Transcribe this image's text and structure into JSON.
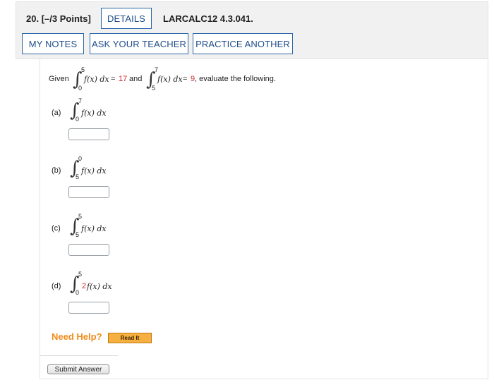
{
  "header": {
    "question_number": "20.",
    "points": "[–/3 Points]",
    "details_label": "DETAILS",
    "code": "LARCALC12 4.3.041.",
    "my_notes_label": "MY NOTES",
    "ask_teacher_label": "ASK YOUR TEACHER",
    "practice_label": "PRACTICE ANOTHER"
  },
  "given": {
    "prefix": "Given",
    "int1": {
      "lower": "0",
      "upper": "5",
      "integrand": "f(x) dx",
      "equals": "=",
      "value": "17"
    },
    "and": "and",
    "int2": {
      "lower": "5",
      "upper": "7",
      "integrand": "f(x) dx",
      "equals": "=",
      "value": "9"
    },
    "suffix": ", evaluate the following."
  },
  "parts": [
    {
      "label": "(a)",
      "lower": "0",
      "upper": "7",
      "coef": "",
      "integrand": "f(x) dx"
    },
    {
      "label": "(b)",
      "lower": "5",
      "upper": "0",
      "coef": "",
      "integrand": "f(x) dx"
    },
    {
      "label": "(c)",
      "lower": "5",
      "upper": "5",
      "coef": "",
      "integrand": "f(x) dx"
    },
    {
      "label": "(d)",
      "lower": "0",
      "upper": "5",
      "coef": "2",
      "integrand": "f(x) dx"
    }
  ],
  "help": {
    "need_help": "Need Help?",
    "read_it": "Read It"
  },
  "submit_label": "Submit Answer",
  "colors": {
    "button_border": "#2a67a8",
    "highlight_red": "#d23232",
    "help_orange": "#f08c1a"
  }
}
